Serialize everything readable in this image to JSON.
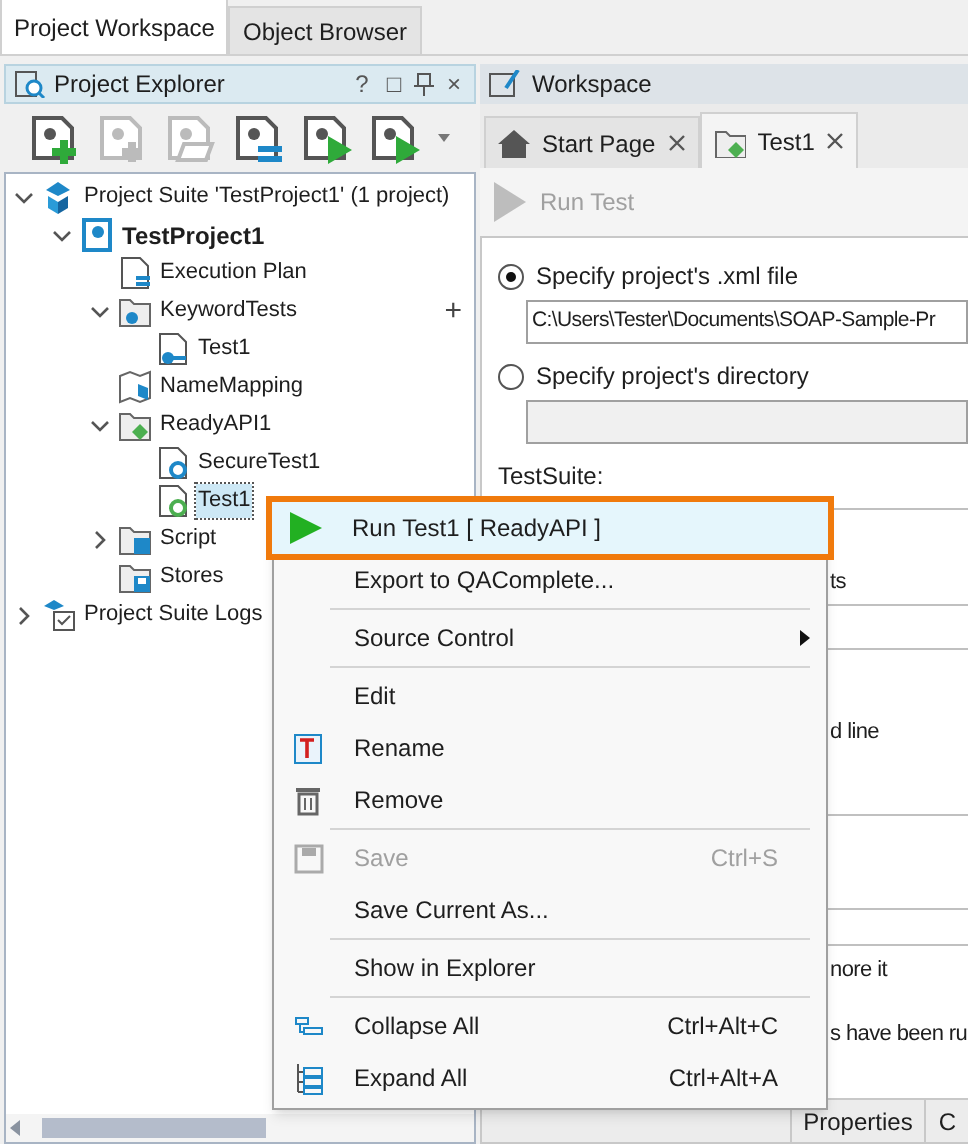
{
  "top_tabs": [
    {
      "label": "Project Workspace",
      "selected": true
    },
    {
      "label": "Object Browser",
      "selected": false
    }
  ],
  "explorer": {
    "title": "Project Explorer",
    "controls": [
      "?",
      "□",
      "×"
    ],
    "tree": [
      {
        "label": "Project Suite 'TestProject1' (1 project)",
        "kind": "suite",
        "expanded": true,
        "selected": false,
        "children": [
          {
            "label": "TestProject1",
            "kind": "project",
            "expanded": true,
            "selected": false,
            "children": [
              {
                "label": "Execution Plan",
                "kind": "plan",
                "selected": false
              },
              {
                "label": "KeywordTests",
                "kind": "keyword-folder",
                "expanded": true,
                "selected": false,
                "action": "+",
                "children": [
                  {
                    "label": "Test1",
                    "kind": "keyword-test",
                    "selected": false
                  }
                ]
              },
              {
                "label": "NameMapping",
                "kind": "mapping",
                "selected": false
              },
              {
                "label": "ReadyAPI1",
                "kind": "readyapi-folder",
                "expanded": true,
                "selected": false,
                "children": [
                  {
                    "label": "SecureTest1",
                    "kind": "secure-test",
                    "selected": false
                  },
                  {
                    "label": "Test1",
                    "kind": "readyapi-test",
                    "selected": true
                  }
                ]
              },
              {
                "label": "Script",
                "kind": "script",
                "expanded": false,
                "selected": false
              },
              {
                "label": "Stores",
                "kind": "stores",
                "selected": false
              }
            ]
          }
        ]
      },
      {
        "label": "Project Suite Logs",
        "kind": "logs",
        "expanded": false,
        "selected": false
      }
    ]
  },
  "workspace": {
    "title": "Workspace",
    "tabs": [
      {
        "label": "Start Page",
        "kind": "home",
        "selected": false
      },
      {
        "label": "Test1",
        "kind": "readyapi",
        "selected": true
      }
    ],
    "run_button": {
      "label": "Run Test",
      "disabled": true
    },
    "options": [
      {
        "label": "Specify project's .xml file",
        "selected": true,
        "value": "C:\\Users\\Tester\\Documents\\SOAP-Sample-Pr"
      },
      {
        "label": "Specify project's directory",
        "selected": false
      }
    ],
    "testsuite_label": "TestSuite:",
    "partial_lines": [
      "ts",
      "d line",
      "nore it",
      "s have been ru"
    ],
    "bottom_tabs": [
      {
        "label": "Properties"
      },
      {
        "label": "C"
      }
    ]
  },
  "context_menu": [
    {
      "kind": "run",
      "label": "Run Test1  [ ReadyAPI ]",
      "selected": true,
      "disabled": false
    },
    {
      "kind": "plain",
      "label": "Export to QAComplete...",
      "selected": false,
      "disabled": false
    },
    {
      "kind": "separator"
    },
    {
      "kind": "submenu",
      "label": "Source Control",
      "selected": false,
      "disabled": false
    },
    {
      "kind": "separator"
    },
    {
      "kind": "plain",
      "label": "Edit",
      "selected": false,
      "disabled": false
    },
    {
      "kind": "rename",
      "label": "Rename",
      "selected": false,
      "disabled": false
    },
    {
      "kind": "remove",
      "label": "Remove",
      "selected": false,
      "disabled": false
    },
    {
      "kind": "separator"
    },
    {
      "kind": "save",
      "label": "Save",
      "shortcut": "Ctrl+S",
      "selected": false,
      "disabled": true
    },
    {
      "kind": "plain",
      "label": "Save Current As...",
      "selected": false,
      "disabled": false
    },
    {
      "kind": "separator"
    },
    {
      "kind": "plain",
      "label": "Show in Explorer",
      "selected": false,
      "disabled": false
    },
    {
      "kind": "separator"
    },
    {
      "kind": "collapse",
      "label": "Collapse All",
      "shortcut": "Ctrl+Alt+C",
      "selected": false,
      "disabled": false
    },
    {
      "kind": "expand",
      "label": "Expand All",
      "shortcut": "Ctrl+Alt+A",
      "selected": false,
      "disabled": false
    }
  ]
}
